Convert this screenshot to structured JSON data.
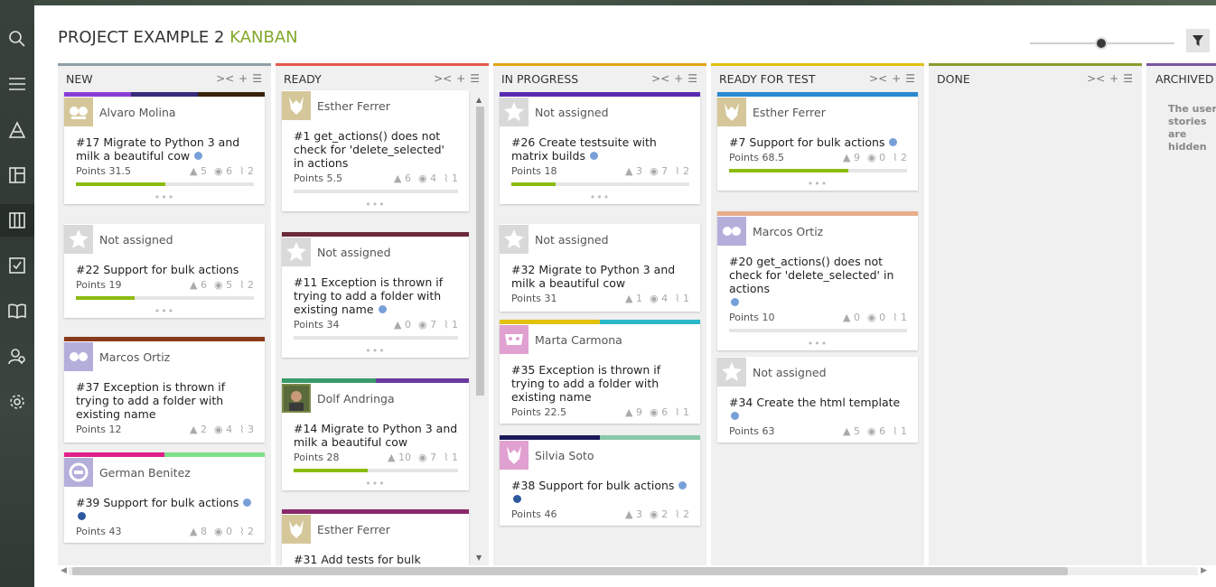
{
  "project": {
    "title": "PROJECT EXAMPLE 2",
    "view": "KANBAN"
  },
  "colors": {
    "accent": "#83a92a",
    "progress": "#8cbb10",
    "dot_light": "#78a0d8",
    "dot_dark": "#2e5aa0"
  },
  "columns": [
    {
      "name": "NEW",
      "color": "#8e9ea6"
    },
    {
      "name": "READY",
      "color": "#e45a4a"
    },
    {
      "name": "IN PROGRESS",
      "color": "#e3a40f"
    },
    {
      "name": "READY FOR TEST",
      "color": "#e3c10f"
    },
    {
      "name": "DONE",
      "color": "#8a9a2a"
    },
    {
      "name": "ARCHIVED",
      "color": "#7b55a0"
    }
  ],
  "archived_message": "The user stories are hidden",
  "cards": [
    {
      "user": "Alvaro Molina",
      "title": "#17 Migrate to Python 3 and milk a beautiful cow",
      "points": "Points 31.5",
      "votes": "5",
      "watchers": "6",
      "attachments": "2"
    },
    {
      "user": "Not assigned",
      "title": "#22 Support for bulk actions",
      "points": "Points 19",
      "votes": "6",
      "watchers": "5",
      "attachments": "2"
    },
    {
      "user": "Marcos Ortiz",
      "title": "#37 Exception is thrown if trying to add a folder with existing name",
      "points": "Points 12",
      "votes": "2",
      "watchers": "4",
      "attachments": "3"
    },
    {
      "user": "German Benitez",
      "title": "#39 Support for bulk actions",
      "points": "Points 43",
      "votes": "8",
      "watchers": "0",
      "attachments": "2"
    },
    {
      "user": "Esther Ferrer",
      "title": "#1 get_actions() does not check for 'delete_selected' in actions",
      "points": "Points 5.5",
      "votes": "6",
      "watchers": "4",
      "attachments": "1"
    },
    {
      "user": "Not assigned",
      "title": "#11 Exception is thrown if trying to add a folder with existing name",
      "points": "Points 34",
      "votes": "0",
      "watchers": "7",
      "attachments": "1"
    },
    {
      "user": "Dolf Andringa",
      "title": "#14 Migrate to Python 3 and milk a beautiful cow",
      "points": "Points 28",
      "votes": "10",
      "watchers": "7",
      "attachments": "1"
    },
    {
      "user": "Esther Ferrer",
      "title": "#31 Add tests for bulk",
      "points": "",
      "votes": "",
      "watchers": "",
      "attachments": ""
    },
    {
      "user": "Not assigned",
      "title": "#26 Create testsuite with matrix builds",
      "points": "Points 18",
      "votes": "3",
      "watchers": "7",
      "attachments": "2"
    },
    {
      "user": "Not assigned",
      "title": "#32 Migrate to Python 3 and milk a beautiful cow",
      "points": "Points 31",
      "votes": "1",
      "watchers": "4",
      "attachments": "1"
    },
    {
      "user": "Marta Carmona",
      "title": "#35 Exception is thrown if trying to add a folder with existing name",
      "points": "Points 22.5",
      "votes": "9",
      "watchers": "6",
      "attachments": "1"
    },
    {
      "user": "Silvia Soto",
      "title": "#38 Support for bulk actions",
      "points": "Points 46",
      "votes": "3",
      "watchers": "2",
      "attachments": "2"
    },
    {
      "user": "Esther Ferrer",
      "title": "#7 Support for bulk actions",
      "points": "Points 68.5",
      "votes": "9",
      "watchers": "0",
      "attachments": "2"
    },
    {
      "user": "Marcos Ortiz",
      "title": "#20 get_actions() does not check for 'delete_selected' in actions",
      "points": "Points 10",
      "votes": "0",
      "watchers": "0",
      "attachments": "1"
    },
    {
      "user": "Not assigned",
      "title": "#34 Create the html template",
      "points": "Points 63",
      "votes": "5",
      "watchers": "6",
      "attachments": "1"
    }
  ],
  "progress": {
    "c0": 0.5,
    "c1": 0.33,
    "c2": 0,
    "c3": 0,
    "c4": 0,
    "c5": 0,
    "c6": 0.45,
    "c8": 0.25,
    "c12": 0.67,
    "c13": 0
  }
}
